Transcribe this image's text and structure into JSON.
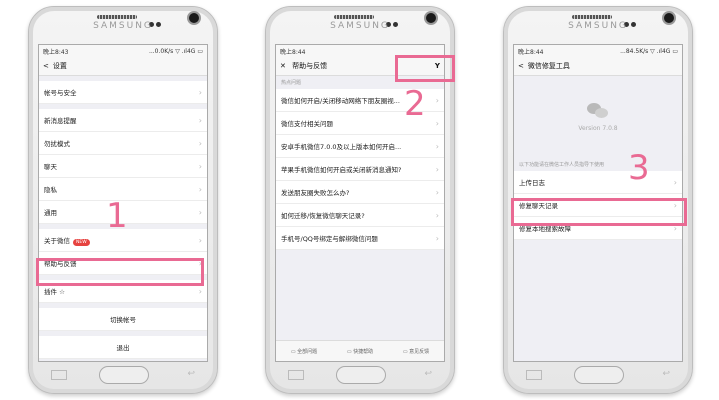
{
  "brand": "SAMSUNG",
  "phone1": {
    "status": {
      "time": "晚上8:43",
      "indicators": "...0.0K/s ▽ .ıl4G ▭"
    },
    "nav": {
      "back": "<",
      "title": "设置"
    },
    "rows": [
      {
        "label": "帐号与安全"
      },
      {
        "label": "新消息提醒"
      },
      {
        "label": "勿扰模式"
      },
      {
        "label": "聊天"
      },
      {
        "label": "隐私"
      },
      {
        "label": "通用"
      },
      {
        "label": "关于微信",
        "badge": "NEW"
      },
      {
        "label": "帮助与反馈"
      },
      {
        "label": "插件 ☆"
      }
    ],
    "switch_account": "切换帐号",
    "logout": "退出",
    "step": "1"
  },
  "phone2": {
    "status": {
      "time": "晚上8:44",
      "indicators": ""
    },
    "nav": {
      "close": "✕",
      "title": "帮助与反馈",
      "action": "Y"
    },
    "section": "热点问题",
    "rows": [
      {
        "label": "微信如何开启/关闭移动网络下朋友圈视..."
      },
      {
        "label": "微信支付相关问题"
      },
      {
        "label": "安卓手机微信7.0.0及以上版本如何开启..."
      },
      {
        "label": "苹果手机微信如何开启或关闭新消息通知?"
      },
      {
        "label": "发送朋友圈失败怎么办?"
      },
      {
        "label": "如何迁移/恢复微信聊天记录?"
      },
      {
        "label": "手机号/QQ号绑定与解绑微信问题"
      }
    ],
    "tabs": [
      "▭ 全部问题",
      "▭ 快捷帮助",
      "▭ 意见反馈"
    ],
    "step": "2"
  },
  "phone3": {
    "status": {
      "time": "晚上8:44",
      "indicators": "...84.5K/s ▽ .ıl4G ▭"
    },
    "nav": {
      "back": "<",
      "title": "微信修复工具"
    },
    "version": "Version 7.0.8",
    "section": "以下功能请在微信工作人员指导下使用",
    "rows": [
      {
        "label": "上传日志"
      },
      {
        "label": "修复聊天记录"
      },
      {
        "label": "修复本地搜索故障"
      }
    ],
    "step": "3"
  }
}
